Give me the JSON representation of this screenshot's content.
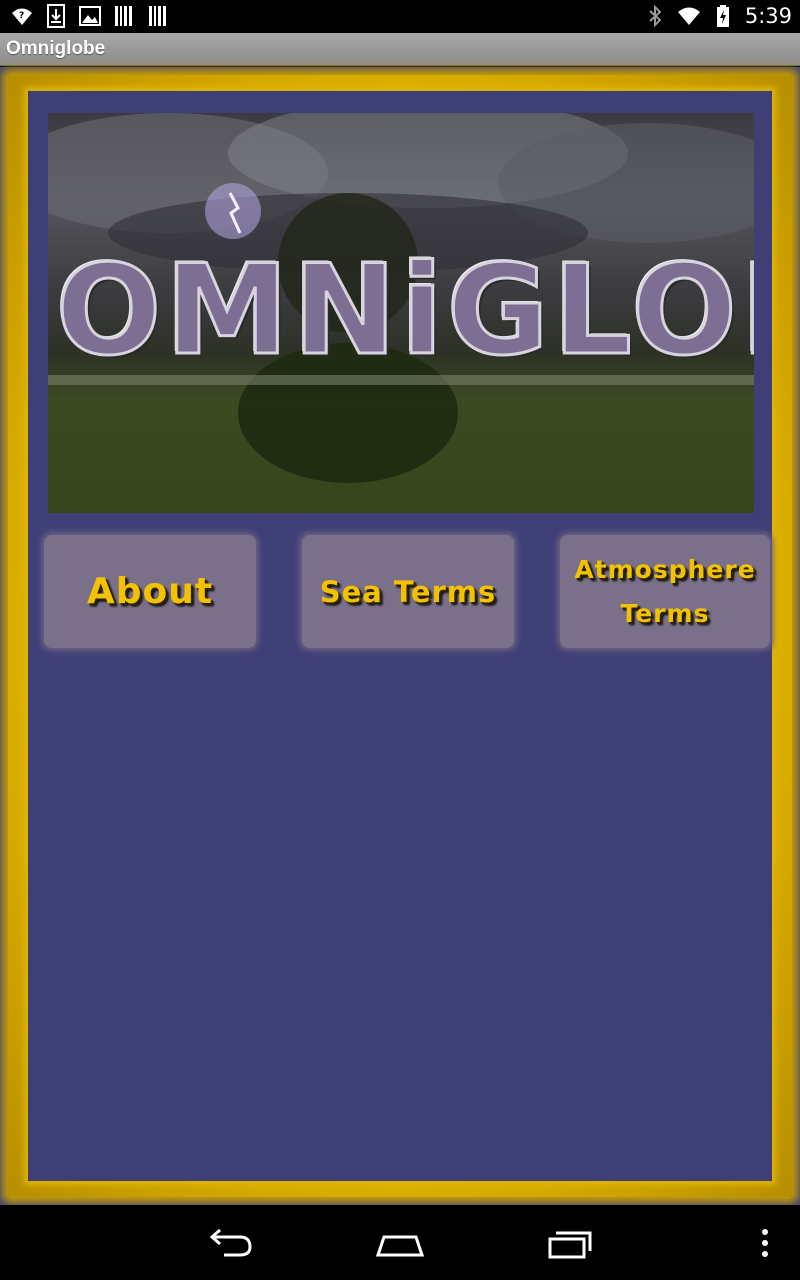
{
  "status_bar": {
    "time": "5:39",
    "left_icons": [
      "wifi-question-icon",
      "download-icon",
      "image-icon",
      "barcode-icon",
      "barcode-icon"
    ],
    "right_icons": [
      "bluetooth-icon",
      "wifi-icon",
      "battery-charging-icon"
    ]
  },
  "title_bar": {
    "title": "Omniglobe"
  },
  "banner": {
    "logo_text": "OMNiGLOBE"
  },
  "buttons": {
    "about": "About",
    "sea_terms": "Sea Terms",
    "atmosphere_terms_line1": "Atmosphere",
    "atmosphere_terms_line2": "Terms"
  },
  "nav_bar": {
    "icons": [
      "back-icon",
      "home-icon",
      "recent-apps-icon",
      "overflow-menu-icon"
    ]
  },
  "colors": {
    "background": "#3f3f78",
    "frame": "#e6b800",
    "button": "#7a7089",
    "button_text": "#f2c200"
  }
}
